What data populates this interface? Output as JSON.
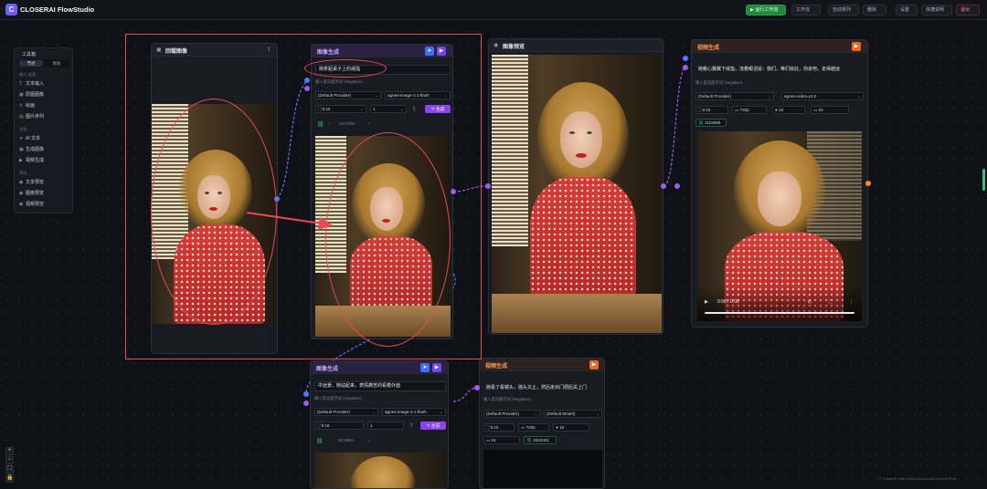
{
  "app": {
    "logo_letter": "C",
    "title": "CLOSERAI FlowStudio"
  },
  "toolbar": {
    "run": "▶ 运行工作流",
    "workflow": "工作流",
    "auto_layout": "自动排列",
    "delete": "删除",
    "settings": "设置",
    "shortcuts": "快捷说明",
    "logout": "退出"
  },
  "sidebar": {
    "title": "工具箱",
    "tabs": [
      "节点",
      "模板"
    ],
    "sections": [
      {
        "label": "输入·处理",
        "items": [
          "文本输入",
          "原图图像",
          "绘画",
          "图片序列"
        ]
      },
      {
        "label": "生成",
        "items": [
          "AI 文本",
          "生成图像",
          "视频生成"
        ]
      },
      {
        "label": "预览",
        "items": [
          "文本预览",
          "图像预览",
          "视频预览"
        ]
      }
    ]
  },
  "node_original": {
    "title": "回载图像"
  },
  "node_gen1": {
    "title": "图像生成",
    "prompt": "她拿起桌子上的戒指",
    "negative_placeholder": "输入反向提示词 (Negative)...",
    "provider": "(Default Provider)",
    "model": "agnes-image-2.1-flash",
    "ratio": "9:16",
    "count": "1",
    "generate": "生成",
    "seed": "3273792"
  },
  "node_preview": {
    "title": "图像预览"
  },
  "node_video1": {
    "title": "视频生成",
    "prompt": "她戴心翼翼下戒指，流着眼泪说：我们，难们就此，你走吧，走得越远",
    "negative_placeholder": "输入反向提示词 (Negative)...",
    "provider": "(Default Provider)",
    "model": "agnes-video-v2.0",
    "ratio": "9:16",
    "resolution": "720p",
    "duration": "10",
    "fps": "24",
    "seed": "1119685",
    "time": "0:08 / 0:08"
  },
  "node_gen2": {
    "title": "图像生成",
    "prompt": "中远景，她站起来，表情痛苦的看着外面",
    "negative_placeholder": "输入反向提示词 (Negative)...",
    "provider": "(Default Provider)",
    "model": "agnes-image-2.1-flash",
    "ratio": "9:16",
    "count": "1",
    "generate": "生成",
    "seed": "5214801"
  },
  "node_video2": {
    "title": "视频生成",
    "prompt": "她看了看镜头，摇头又止，然后走出门把后关上门",
    "negative_placeholder": "输入反向提示词 (Negative)...",
    "provider": "(Default Provider)",
    "model": "(Default Model)",
    "ratio": "9:16",
    "resolution": "720p",
    "duration": "10",
    "fps": "24",
    "seed": "2524401"
  },
  "footer": {
    "credit": "© CloserAI  https://api.closerai.com by Vue Flow"
  },
  "colors": {
    "accent_purple": "#8b45f0",
    "accent_orange": "#f0661c",
    "run_green": "#1f8a3e",
    "highlight_red": "#e84a55"
  }
}
